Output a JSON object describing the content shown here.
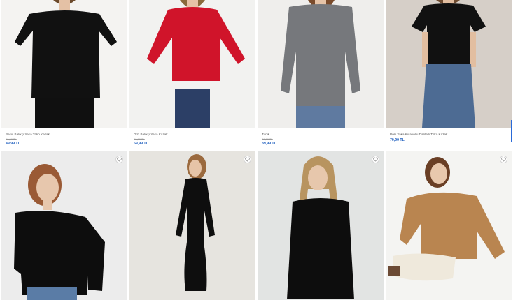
{
  "products_row1": [
    {
      "name": "Basic Balıkçı Yaka Triko Kazak",
      "old_price": "69,99 TL",
      "price": "49,99 TL",
      "color": "#111111",
      "bg": "#f4f3f1",
      "skin": "#e4c1a5",
      "hair": "#6b4a2c",
      "pants": "#101010"
    },
    {
      "name": "Düz Balıkçı Yaka Kazak",
      "old_price": "69,99 TL",
      "price": "59,99 TL",
      "color": "#d0142a",
      "bg": "#f2f2f0",
      "skin": "#e6c2a6",
      "hair": "#8a6a3c",
      "pants": "#2c3f66"
    },
    {
      "name": "Tunik",
      "old_price": "49,99 TL",
      "price": "39,99 TL",
      "color": "#76787c",
      "bg": "#efeeec",
      "skin": "#e5c3a7",
      "hair": "#7a4b2b",
      "pants": "#5f7aa0"
    },
    {
      "name": "Polo Yaka Kısakollu Dantelli Triko Kazak",
      "old_price": "",
      "price": "79,99 TL",
      "color": "#111111",
      "bg": "#d6cfc8",
      "skin": "#e2bea0",
      "hair": "#6e4b30",
      "pants": "#4d6b93"
    }
  ],
  "products_row2": [
    {
      "color": "#0d0d0d",
      "bg": "#ececec",
      "skin": "#e7c7ad",
      "hair": "#9a5a35",
      "pants": "#5a7ca6"
    },
    {
      "color": "#0e0e0e",
      "bg": "#e6e4df",
      "skin": "#e6c4a7",
      "hair": "#9b6a3e",
      "pants": "#0e0e0e"
    },
    {
      "color": "#0d0d0d",
      "bg": "#e2e4e3",
      "skin": "#e7c7ac",
      "hair": "#b89460",
      "pants": "#0d0d0d"
    },
    {
      "color": "#b98550",
      "bg": "#f4f4f2",
      "skin": "#e8c8ad",
      "hair": "#6a3f25",
      "pants": "#efe9dc"
    }
  ],
  "icons": {
    "favorite": "heart-outline-icon"
  }
}
